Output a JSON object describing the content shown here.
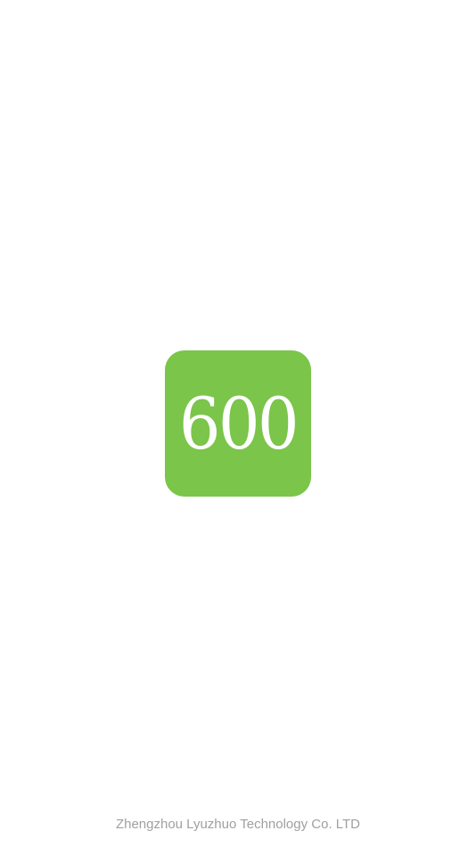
{
  "splash": {
    "logo_text": "600",
    "logo_color": "#7ac54a",
    "logo_icon": "app-logo-icon"
  },
  "footer": {
    "company": "Zhengzhou Lyuzhuo Technology Co. LTD"
  }
}
